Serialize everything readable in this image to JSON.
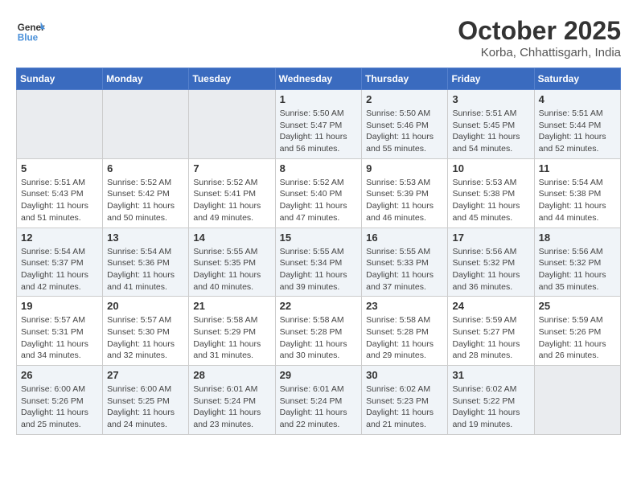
{
  "header": {
    "logo_line1": "General",
    "logo_line2": "Blue",
    "month": "October 2025",
    "location": "Korba, Chhattisgarh, India"
  },
  "weekdays": [
    "Sunday",
    "Monday",
    "Tuesday",
    "Wednesday",
    "Thursday",
    "Friday",
    "Saturday"
  ],
  "weeks": [
    [
      {
        "day": "",
        "info": ""
      },
      {
        "day": "",
        "info": ""
      },
      {
        "day": "",
        "info": ""
      },
      {
        "day": "1",
        "info": "Sunrise: 5:50 AM\nSunset: 5:47 PM\nDaylight: 11 hours and 56 minutes."
      },
      {
        "day": "2",
        "info": "Sunrise: 5:50 AM\nSunset: 5:46 PM\nDaylight: 11 hours and 55 minutes."
      },
      {
        "day": "3",
        "info": "Sunrise: 5:51 AM\nSunset: 5:45 PM\nDaylight: 11 hours and 54 minutes."
      },
      {
        "day": "4",
        "info": "Sunrise: 5:51 AM\nSunset: 5:44 PM\nDaylight: 11 hours and 52 minutes."
      }
    ],
    [
      {
        "day": "5",
        "info": "Sunrise: 5:51 AM\nSunset: 5:43 PM\nDaylight: 11 hours and 51 minutes."
      },
      {
        "day": "6",
        "info": "Sunrise: 5:52 AM\nSunset: 5:42 PM\nDaylight: 11 hours and 50 minutes."
      },
      {
        "day": "7",
        "info": "Sunrise: 5:52 AM\nSunset: 5:41 PM\nDaylight: 11 hours and 49 minutes."
      },
      {
        "day": "8",
        "info": "Sunrise: 5:52 AM\nSunset: 5:40 PM\nDaylight: 11 hours and 47 minutes."
      },
      {
        "day": "9",
        "info": "Sunrise: 5:53 AM\nSunset: 5:39 PM\nDaylight: 11 hours and 46 minutes."
      },
      {
        "day": "10",
        "info": "Sunrise: 5:53 AM\nSunset: 5:38 PM\nDaylight: 11 hours and 45 minutes."
      },
      {
        "day": "11",
        "info": "Sunrise: 5:54 AM\nSunset: 5:38 PM\nDaylight: 11 hours and 44 minutes."
      }
    ],
    [
      {
        "day": "12",
        "info": "Sunrise: 5:54 AM\nSunset: 5:37 PM\nDaylight: 11 hours and 42 minutes."
      },
      {
        "day": "13",
        "info": "Sunrise: 5:54 AM\nSunset: 5:36 PM\nDaylight: 11 hours and 41 minutes."
      },
      {
        "day": "14",
        "info": "Sunrise: 5:55 AM\nSunset: 5:35 PM\nDaylight: 11 hours and 40 minutes."
      },
      {
        "day": "15",
        "info": "Sunrise: 5:55 AM\nSunset: 5:34 PM\nDaylight: 11 hours and 39 minutes."
      },
      {
        "day": "16",
        "info": "Sunrise: 5:55 AM\nSunset: 5:33 PM\nDaylight: 11 hours and 37 minutes."
      },
      {
        "day": "17",
        "info": "Sunrise: 5:56 AM\nSunset: 5:32 PM\nDaylight: 11 hours and 36 minutes."
      },
      {
        "day": "18",
        "info": "Sunrise: 5:56 AM\nSunset: 5:32 PM\nDaylight: 11 hours and 35 minutes."
      }
    ],
    [
      {
        "day": "19",
        "info": "Sunrise: 5:57 AM\nSunset: 5:31 PM\nDaylight: 11 hours and 34 minutes."
      },
      {
        "day": "20",
        "info": "Sunrise: 5:57 AM\nSunset: 5:30 PM\nDaylight: 11 hours and 32 minutes."
      },
      {
        "day": "21",
        "info": "Sunrise: 5:58 AM\nSunset: 5:29 PM\nDaylight: 11 hours and 31 minutes."
      },
      {
        "day": "22",
        "info": "Sunrise: 5:58 AM\nSunset: 5:28 PM\nDaylight: 11 hours and 30 minutes."
      },
      {
        "day": "23",
        "info": "Sunrise: 5:58 AM\nSunset: 5:28 PM\nDaylight: 11 hours and 29 minutes."
      },
      {
        "day": "24",
        "info": "Sunrise: 5:59 AM\nSunset: 5:27 PM\nDaylight: 11 hours and 28 minutes."
      },
      {
        "day": "25",
        "info": "Sunrise: 5:59 AM\nSunset: 5:26 PM\nDaylight: 11 hours and 26 minutes."
      }
    ],
    [
      {
        "day": "26",
        "info": "Sunrise: 6:00 AM\nSunset: 5:26 PM\nDaylight: 11 hours and 25 minutes."
      },
      {
        "day": "27",
        "info": "Sunrise: 6:00 AM\nSunset: 5:25 PM\nDaylight: 11 hours and 24 minutes."
      },
      {
        "day": "28",
        "info": "Sunrise: 6:01 AM\nSunset: 5:24 PM\nDaylight: 11 hours and 23 minutes."
      },
      {
        "day": "29",
        "info": "Sunrise: 6:01 AM\nSunset: 5:24 PM\nDaylight: 11 hours and 22 minutes."
      },
      {
        "day": "30",
        "info": "Sunrise: 6:02 AM\nSunset: 5:23 PM\nDaylight: 11 hours and 21 minutes."
      },
      {
        "day": "31",
        "info": "Sunrise: 6:02 AM\nSunset: 5:22 PM\nDaylight: 11 hours and 19 minutes."
      },
      {
        "day": "",
        "info": ""
      }
    ]
  ]
}
